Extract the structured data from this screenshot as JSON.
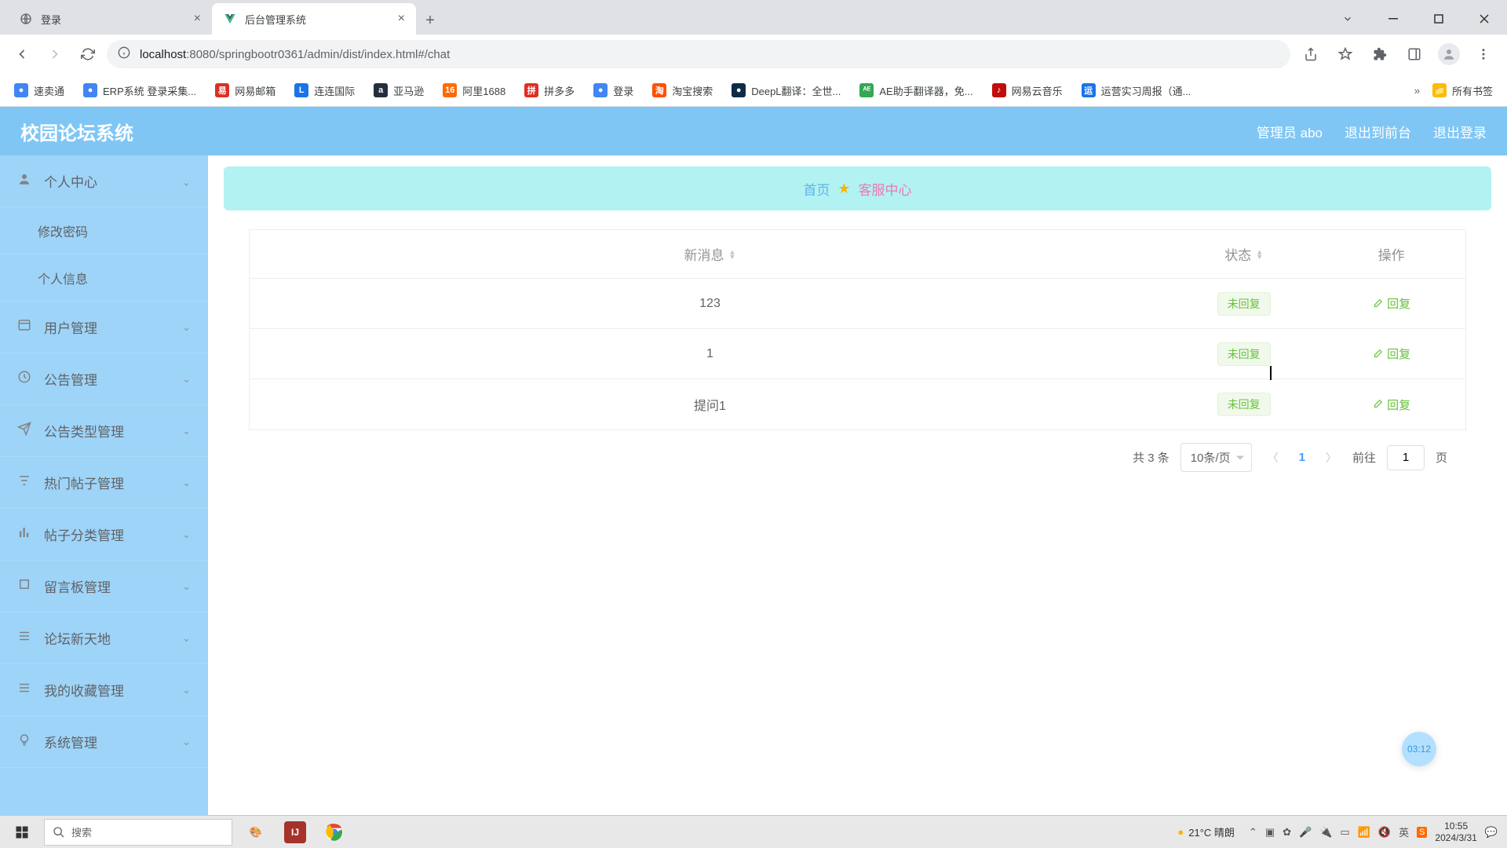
{
  "browser": {
    "tabs": [
      {
        "title": "登录",
        "active": false
      },
      {
        "title": "后台管理系统",
        "active": true
      }
    ],
    "url_host": "localhost",
    "url_port": ":8080",
    "url_path": "/springbootr0361/admin/dist/index.html#/chat"
  },
  "bookmarks": [
    {
      "label": "速卖通",
      "color": "#4285f4"
    },
    {
      "label": "ERP系统 登录采集...",
      "color": "#4285f4"
    },
    {
      "label": "网易邮箱",
      "color": "#d93025"
    },
    {
      "label": "连连国际",
      "color": "#1a73e8"
    },
    {
      "label": "亚马逊",
      "color": "#232f3e"
    },
    {
      "label": "阿里1688",
      "color": "#ff6a00"
    },
    {
      "label": "拼多多",
      "color": "#e02e24"
    },
    {
      "label": "登录",
      "color": "#4285f4"
    },
    {
      "label": "淘宝搜索",
      "color": "#ff5000"
    },
    {
      "label": "DeepL翻译：全世...",
      "color": "#0f2b46"
    },
    {
      "label": "AE助手翻译器，免...",
      "color": "#34a853"
    },
    {
      "label": "网易云音乐",
      "color": "#c20c0c"
    },
    {
      "label": "运营实习周报（通...",
      "color": "#1a73e8"
    }
  ],
  "bookmarks_all": "所有书签",
  "app": {
    "title": "校园论坛系统",
    "user_label": "管理员 abo",
    "exit_front": "退出到前台",
    "logout": "退出登录"
  },
  "sidebar": {
    "items": [
      {
        "label": "个人中心",
        "icon": "user",
        "expanded": true,
        "children": [
          {
            "label": "修改密码"
          },
          {
            "label": "个人信息"
          }
        ]
      },
      {
        "label": "用户管理",
        "icon": "users",
        "expanded": false
      },
      {
        "label": "公告管理",
        "icon": "clock",
        "expanded": false
      },
      {
        "label": "公告类型管理",
        "icon": "send",
        "expanded": false
      },
      {
        "label": "热门帖子管理",
        "icon": "filter",
        "expanded": false
      },
      {
        "label": "帖子分类管理",
        "icon": "bar",
        "expanded": false
      },
      {
        "label": "留言板管理",
        "icon": "crop",
        "expanded": false
      },
      {
        "label": "论坛新天地",
        "icon": "list",
        "expanded": false
      },
      {
        "label": "我的收藏管理",
        "icon": "list",
        "expanded": false
      },
      {
        "label": "系统管理",
        "icon": "bulb",
        "expanded": false
      }
    ]
  },
  "breadcrumb": {
    "home": "首页",
    "current": "客服中心"
  },
  "table": {
    "headers": {
      "message": "新消息",
      "status": "状态",
      "operation": "操作"
    },
    "reply_label": "回复",
    "rows": [
      {
        "message": "123",
        "status": "未回复"
      },
      {
        "message": "1",
        "status": "未回复"
      },
      {
        "message": "提问1",
        "status": "未回复"
      }
    ]
  },
  "pagination": {
    "total_text": "共 3 条",
    "page_size_label": "10条/页",
    "current": "1",
    "goto_prefix": "前往",
    "goto_value": "1",
    "goto_suffix": "页"
  },
  "float_badge": "03:12",
  "taskbar": {
    "search_placeholder": "搜索",
    "weather": "21°C 晴朗",
    "ime": "英",
    "time": "10:55",
    "date": "2024/3/31"
  }
}
